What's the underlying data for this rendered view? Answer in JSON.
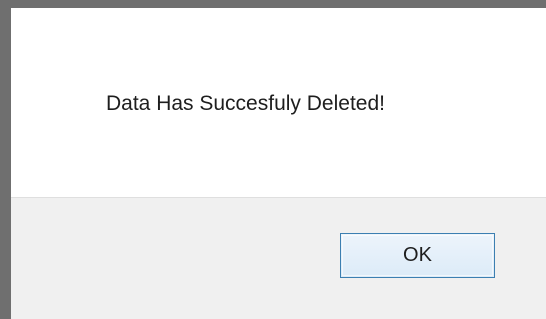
{
  "dialog": {
    "message": "Data Has Succesfuly Deleted!",
    "ok_label": "OK"
  }
}
